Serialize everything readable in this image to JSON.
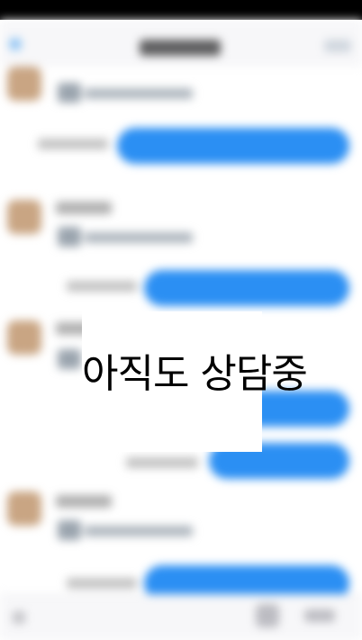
{
  "overlay": {
    "label": "아직도 상담중"
  },
  "colors": {
    "bubble": "#2b8ff3",
    "avatar": "#c9a583",
    "status_bar": "#000000"
  },
  "icons": {
    "back": "chevron-left-icon",
    "attachment": "file-icon",
    "keyboard": "keyboard-icon"
  }
}
